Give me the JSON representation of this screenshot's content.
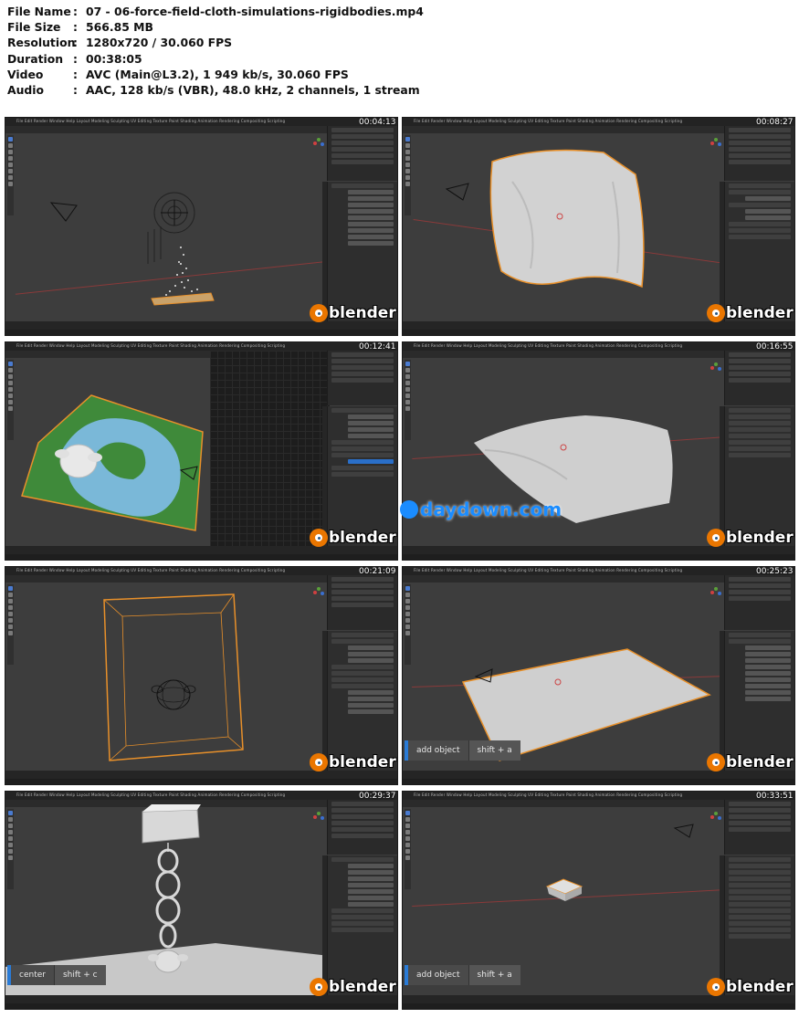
{
  "file_info": [
    {
      "key": "File Name",
      "value": "07 - 06-force-field-cloth-simulations-rigidbodies.mp4"
    },
    {
      "key": "File Size",
      "value": "566.85 MB"
    },
    {
      "key": "Resolution",
      "value": "1280x720 / 30.060 FPS"
    },
    {
      "key": "Duration",
      "value": "00:38:05"
    },
    {
      "key": "Video",
      "value": "AVC (Main@L3.2), 1 949 kb/s, 30.060 FPS"
    },
    {
      "key": "Audio",
      "value": "AAC, 128 kb/s (VBR), 48.0 kHz, 2 channels, 1 stream"
    }
  ],
  "separator": ":",
  "app": {
    "menu": "File  Edit  Render  Window  Help   Layout  Modeling  Sculpting  UV Editing  Texture Paint  Shading  Animation  Rendering  Compositing  Scripting",
    "logo_word": "blender",
    "colors": {
      "accent": "#ea7600",
      "selection": "#e8902a",
      "viewport": "#3d3d3d"
    }
  },
  "thumbnails": [
    {
      "timecode": "00:04:13",
      "scene": "force-field"
    },
    {
      "timecode": "00:08:27",
      "scene": "cloth-drape"
    },
    {
      "timecode": "00:12:41",
      "scene": "dynamic-paint"
    },
    {
      "timecode": "00:16:55",
      "scene": "cloth-plane"
    },
    {
      "timecode": "00:21:09",
      "scene": "smoke-domain"
    },
    {
      "timecode": "00:25:23",
      "scene": "plane-camera",
      "overlay": {
        "action": "add object",
        "keys": "shift + a"
      }
    },
    {
      "timecode": "00:29:37",
      "scene": "chain-rings",
      "overlay": {
        "action": "center",
        "keys": "shift + c"
      }
    },
    {
      "timecode": "00:33:51",
      "scene": "small-cube",
      "overlay": {
        "action": "add object",
        "keys": "shift + a"
      }
    }
  ],
  "watermark": {
    "text": "daydown.com",
    "icon": "daydown-logo-icon"
  }
}
